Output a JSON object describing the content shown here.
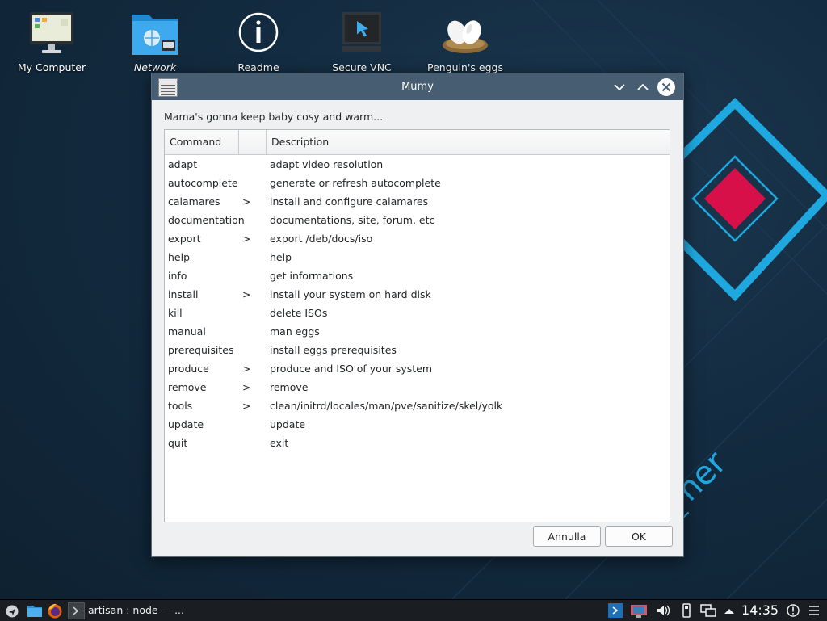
{
  "desktop": {
    "icons": [
      {
        "label": "My Computer"
      },
      {
        "label": "Network"
      },
      {
        "label": "Readme"
      },
      {
        "label": "Secure VNC"
      },
      {
        "label": "Penguin's eggs"
      }
    ],
    "wallpaper_text": [
      "ner",
      "RE"
    ],
    "accent_color": "#1fa8e0",
    "diamond_color": "#d8104a"
  },
  "dialog": {
    "title": "Mumy",
    "message": "Mama's gonna keep baby cosy and warm...",
    "columns": [
      "Command",
      "",
      "Description"
    ],
    "rows": [
      {
        "command": "adapt",
        "arrow": "",
        "description": "adapt video resolution"
      },
      {
        "command": "autocomplete",
        "arrow": "",
        "description": "generate or refresh autocomplete"
      },
      {
        "command": "calamares",
        "arrow": ">",
        "description": "install and configure calamares"
      },
      {
        "command": "documentation",
        "arrow": "",
        "description": "documentations, site, forum, etc"
      },
      {
        "command": "export",
        "arrow": ">",
        "description": "export /deb/docs/iso"
      },
      {
        "command": "help",
        "arrow": "",
        "description": "help"
      },
      {
        "command": "info",
        "arrow": "",
        "description": "get informations"
      },
      {
        "command": "install",
        "arrow": ">",
        "description": "install your system on hard disk"
      },
      {
        "command": "kill",
        "arrow": "",
        "description": "delete ISOs"
      },
      {
        "command": "manual",
        "arrow": "",
        "description": "man eggs"
      },
      {
        "command": "prerequisites",
        "arrow": "",
        "description": "install eggs prerequisites"
      },
      {
        "command": "produce",
        "arrow": ">",
        "description": "produce and ISO of your system"
      },
      {
        "command": "remove",
        "arrow": ">",
        "description": "remove"
      },
      {
        "command": "tools",
        "arrow": ">",
        "description": "clean/initrd/locales/man/pve/sanitize/skel/yolk"
      },
      {
        "command": "update",
        "arrow": "",
        "description": "update"
      },
      {
        "command": "quit",
        "arrow": "",
        "description": "exit"
      }
    ],
    "cancel_label": "Annulla",
    "ok_label": "OK"
  },
  "taskbar": {
    "task_label": "artisan : node — ...",
    "clock": "14:35"
  }
}
